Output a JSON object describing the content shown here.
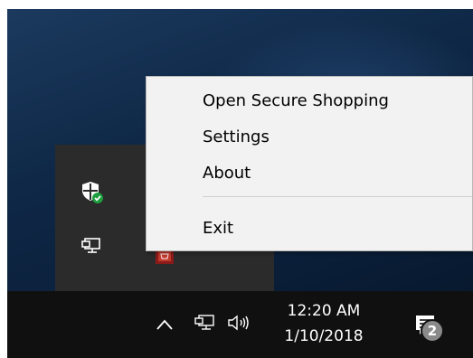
{
  "context_menu": {
    "items": [
      {
        "label": "Open Secure Shopping"
      },
      {
        "label": "Settings"
      },
      {
        "label": "About"
      },
      {
        "label": "Exit"
      }
    ]
  },
  "overflow_tray": {
    "icons": [
      {
        "name": "windows-defender-shield-icon"
      },
      {
        "name": "secure-shopping-icon"
      },
      {
        "name": "network-icon"
      }
    ]
  },
  "taskbar": {
    "clock": {
      "time": "12:20 AM",
      "date": "1/10/2018"
    },
    "action_center": {
      "notification_count": "2"
    },
    "icons": {
      "chevron": "chevron-up-icon",
      "network": "network-icon",
      "volume": "volume-icon",
      "action_center": "action-center-icon"
    }
  },
  "colors": {
    "taskbar_bg": "#101010",
    "overflow_bg": "#2b2b2b",
    "menu_bg": "#f2f2f2",
    "defender_green": "#1e9e3e",
    "shopping_red": "#c0392b"
  }
}
